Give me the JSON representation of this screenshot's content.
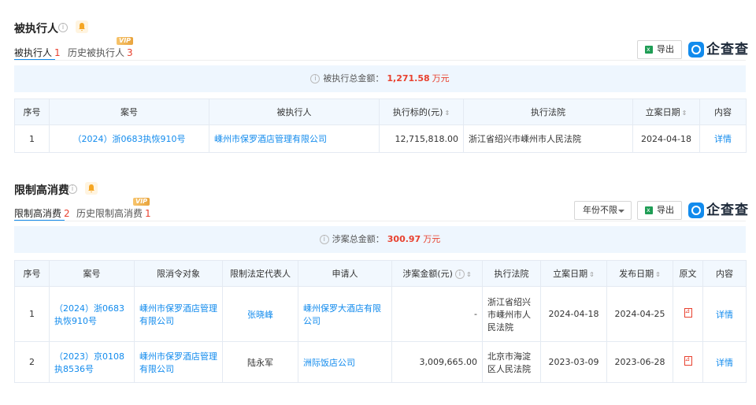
{
  "section1": {
    "title": "被执行人",
    "tabs": [
      {
        "label": "被执行人",
        "count": "1"
      },
      {
        "label": "历史被执行人",
        "count": "3"
      }
    ],
    "vip_badge": "VIP",
    "export_label": "导出",
    "brand": "企查查",
    "summary_label": "被执行总金额：",
    "summary_amount": "1,271.58",
    "summary_unit": "万元",
    "headers": [
      "序号",
      "案号",
      "被执行人",
      "执行标的(元)",
      "执行法院",
      "立案日期",
      "内容"
    ],
    "rows": [
      {
        "no": "1",
        "case": "（2024）浙0683执恢910号",
        "party": "嵊州市保罗酒店管理有限公司",
        "amount": "12,715,818.00",
        "court": "浙江省绍兴市嵊州市人民法院",
        "date": "2024-04-18",
        "detail": "详情"
      }
    ]
  },
  "section2": {
    "title": "限制高消费",
    "tabs": [
      {
        "label": "限制高消费",
        "count": "2"
      },
      {
        "label": "历史限制高消费",
        "count": "1"
      }
    ],
    "vip_badge": "VIP",
    "year_filter": "年份不限",
    "export_label": "导出",
    "brand": "企查查",
    "summary_label": "涉案总金额：",
    "summary_amount": "300.97",
    "summary_unit": "万元",
    "headers": [
      "序号",
      "案号",
      "限消令对象",
      "限制法定代表人",
      "申请人",
      "涉案金额(元)",
      "执行法院",
      "立案日期",
      "发布日期",
      "原文",
      "内容"
    ],
    "rows": [
      {
        "no": "1",
        "case": "（2024）浙0683执恢910号",
        "target": "嵊州市保罗酒店管理有限公司",
        "rep": "张晓峰",
        "applicant": "嵊州保罗大酒店有限公司",
        "amount": "-",
        "court": "浙江省绍兴市嵊州市人民法院",
        "filed": "2024-04-18",
        "published": "2024-04-25",
        "detail": "详情"
      },
      {
        "no": "2",
        "case": "（2023）京0108执8536号",
        "target": "嵊州市保罗酒店管理有限公司",
        "rep": "陆永军",
        "applicant": "洲际饭店公司",
        "amount": "3,009,665.00",
        "court": "北京市海淀区人民法院",
        "filed": "2023-03-09",
        "published": "2023-06-28",
        "detail": "详情"
      }
    ]
  },
  "colors": {
    "accent": "#128bed",
    "red": "#e8412f",
    "header_bg": "#f2f8fe",
    "summary_bg": "#eef6fe"
  },
  "icons": [
    "info-icon",
    "bell-icon",
    "excel-icon",
    "qcc-logo-icon",
    "pdf-icon",
    "sort-icon",
    "caret-down-icon"
  ]
}
